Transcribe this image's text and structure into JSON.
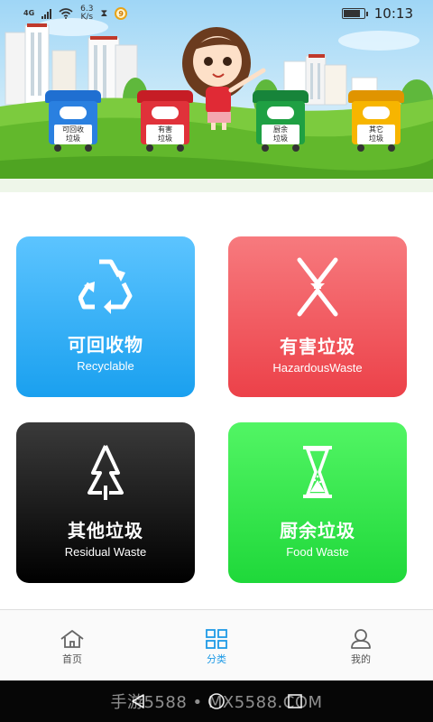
{
  "status_bar": {
    "network": "4G",
    "speed_value": "6.3",
    "speed_unit": "K/s",
    "hourglass": "⧗",
    "app_badge": "9",
    "time": "10:13",
    "battery_level": 0.85
  },
  "banner": {
    "bins": [
      {
        "label_line1": "可回收",
        "label_line2": "垃圾",
        "color": "#1f6fd1"
      },
      {
        "label_line1": "有害",
        "label_line2": "垃圾",
        "color": "#d92027"
      },
      {
        "label_line1": "厨余",
        "label_line2": "垃圾",
        "color": "#1e9b3b"
      },
      {
        "label_line1": "其它",
        "label_line2": "垃圾",
        "color": "#f0a500"
      }
    ]
  },
  "categories": [
    {
      "name_cn": "可回收物",
      "name_en": "Recyclable",
      "icon": "recycle-icon",
      "color": "#1aa0ef"
    },
    {
      "name_cn": "有害垃圾",
      "name_en": "HazardousWaste",
      "icon": "hazard-icon",
      "color": "#ec4149"
    },
    {
      "name_cn": "其他垃圾",
      "name_en": "Residual Waste",
      "icon": "residual-icon",
      "color": "#111111"
    },
    {
      "name_cn": "厨余垃圾",
      "name_en": "Food Waste",
      "icon": "hourglass-icon",
      "color": "#2ad845"
    }
  ],
  "tabs": [
    {
      "label": "首页",
      "icon": "home-icon",
      "active": false
    },
    {
      "label": "分类",
      "icon": "grid-icon",
      "active": true
    },
    {
      "label": "我的",
      "icon": "user-icon",
      "active": false
    }
  ],
  "watermark": "手游5588 • MX5588.COM",
  "colors": {
    "active_tab": "#1e9ae6",
    "inactive_tab": "#555555"
  }
}
